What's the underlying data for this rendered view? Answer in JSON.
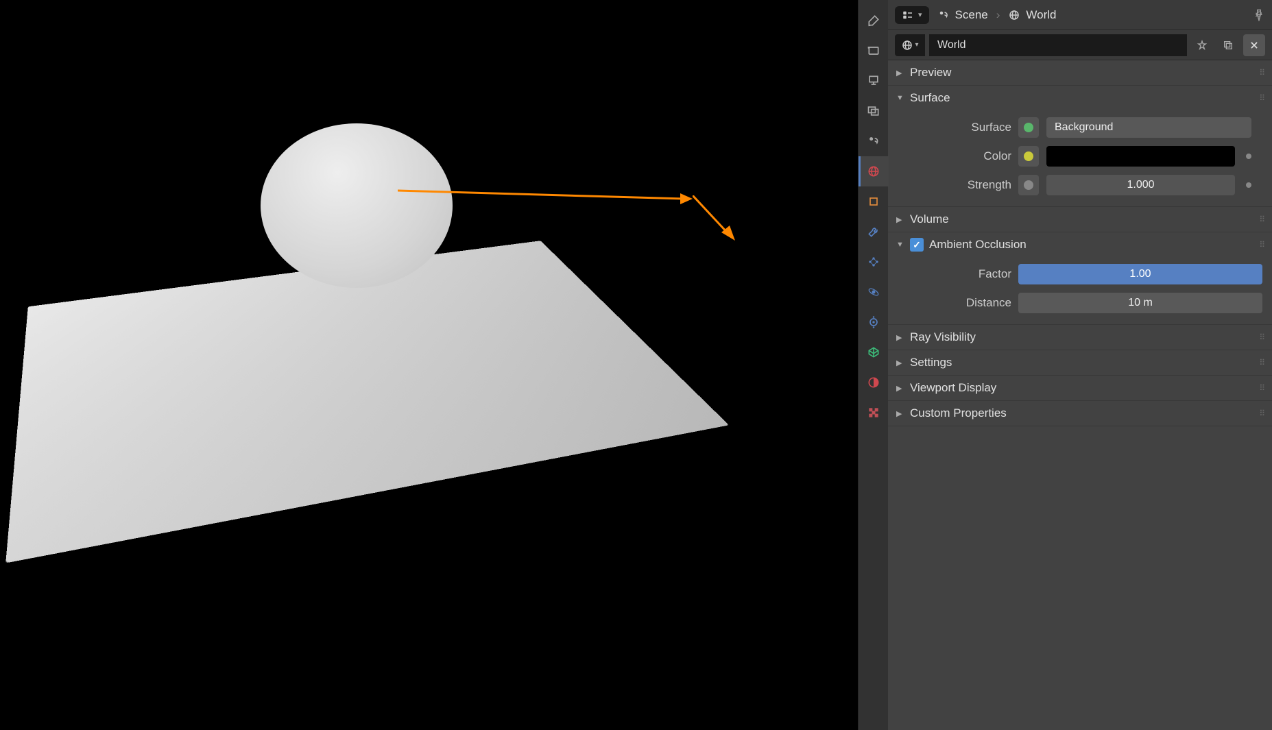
{
  "header": {
    "scene_label": "Scene",
    "world_label": "World"
  },
  "name_field": "World",
  "panels": {
    "preview": "Preview",
    "surface": {
      "title": "Surface",
      "surface_label": "Surface",
      "surface_value": "Background",
      "color_label": "Color",
      "strength_label": "Strength",
      "strength_value": "1.000"
    },
    "volume": "Volume",
    "ao": {
      "title": "Ambient Occlusion",
      "checked": true,
      "factor_label": "Factor",
      "factor_value": "1.00",
      "distance_label": "Distance",
      "distance_value": "10 m"
    },
    "ray": "Ray Visibility",
    "settings": "Settings",
    "viewport": "Viewport Display",
    "custom": "Custom Properties"
  },
  "colors": {
    "accent": "#5680c2",
    "arrow": "#ff8800"
  }
}
